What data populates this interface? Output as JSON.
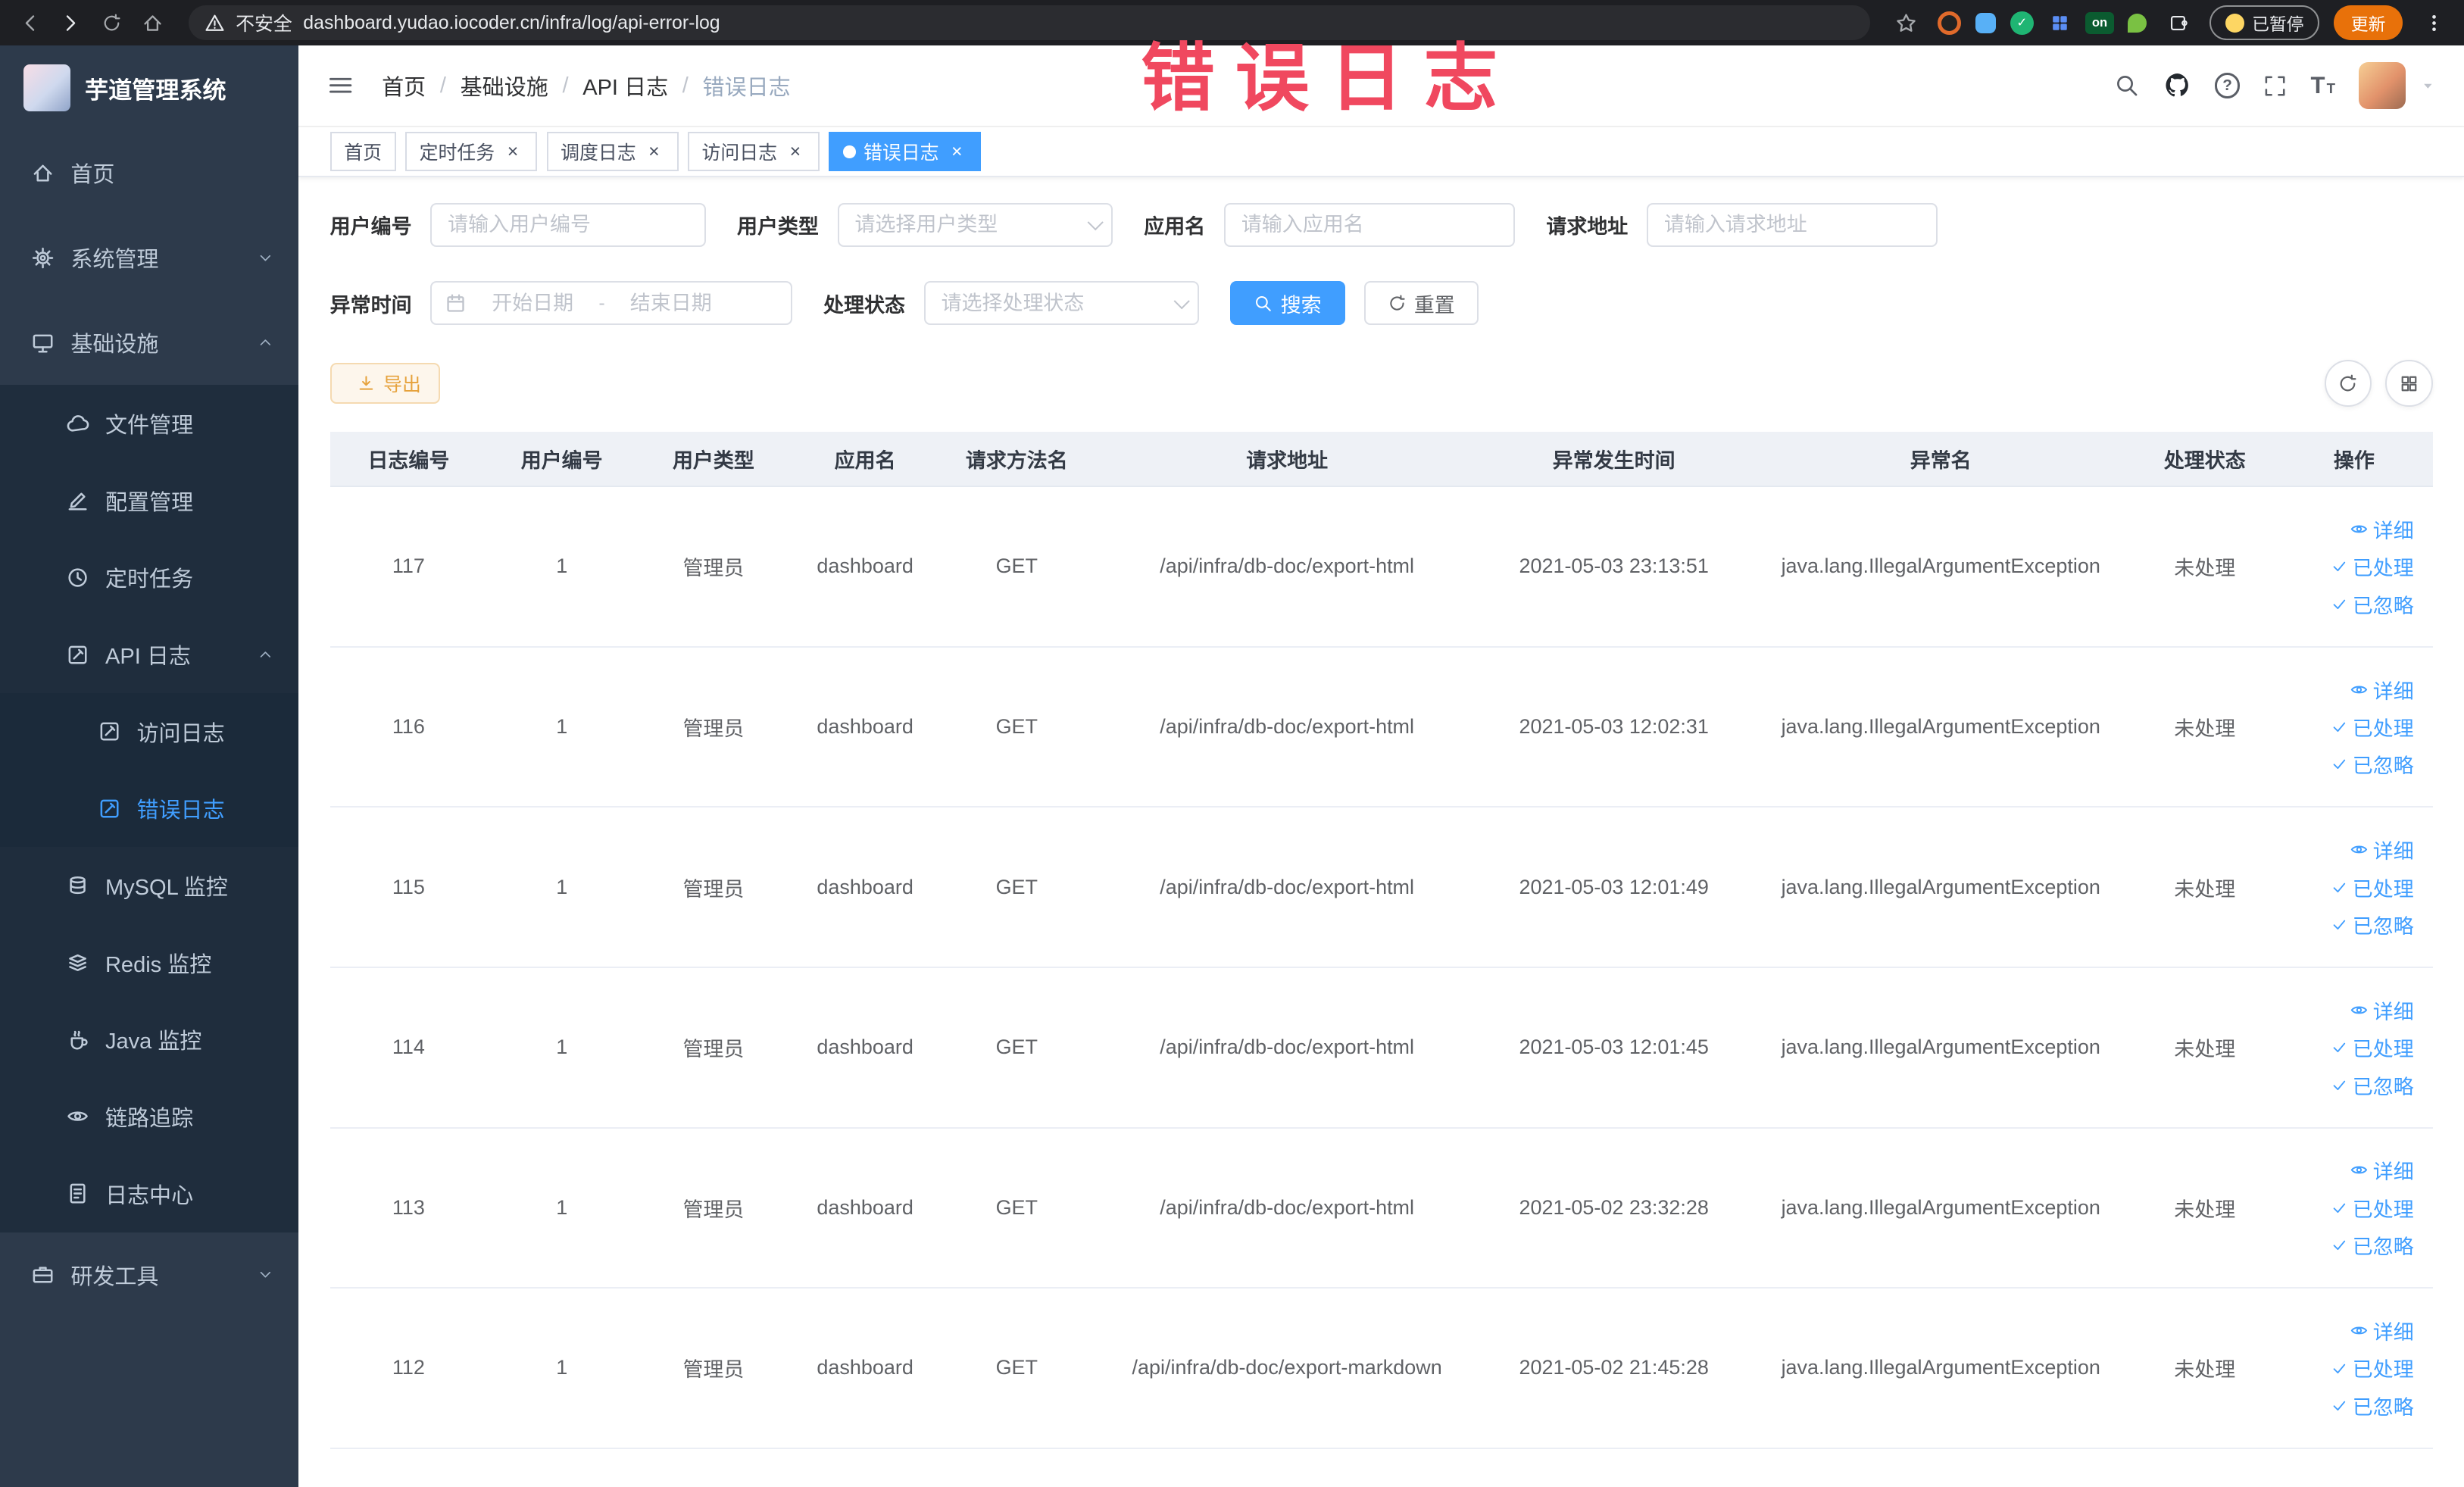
{
  "colors": {
    "primary": "#409EFF",
    "sidebar_bg": "#2d3a4b",
    "sidebar_submenu_bg": "#1f2d3d",
    "sidebar_text": "#bfcbd9",
    "table_header_bg": "#eef1f6",
    "warning_text": "#e6a23c",
    "warning_bg": "#fdf6ec",
    "watermark_color": "#f0485f",
    "chrome_bg": "#1e1f23",
    "update_badge_bg": "#e8710a"
  },
  "browser": {
    "security_warning": "不安全",
    "url": "dashboard.yudao.iocoder.cn/infra/log/api-error-log",
    "extensions_badge": "on",
    "paused_badge": "已暂停",
    "update_button": "更新"
  },
  "watermark": "错误日志",
  "sidebar": {
    "logo_title": "芋道管理系统",
    "items": [
      {
        "label": "首页",
        "icon": "home-icon"
      },
      {
        "label": "系统管理",
        "icon": "gear-icon",
        "arrow": "down"
      },
      {
        "label": "基础设施",
        "icon": "monitor-icon",
        "arrow": "up"
      },
      {
        "label": "文件管理",
        "icon": "cloud-icon"
      },
      {
        "label": "配置管理",
        "icon": "pencil-icon"
      },
      {
        "label": "定时任务",
        "icon": "clock-icon"
      },
      {
        "label": "API 日志",
        "icon": "edit-square-icon",
        "arrow": "up"
      },
      {
        "label": "访问日志",
        "icon": "edit-square-icon"
      },
      {
        "label": "错误日志",
        "icon": "edit-square-icon",
        "active": true
      },
      {
        "label": "MySQL 监控",
        "icon": "database-icon"
      },
      {
        "label": "Redis 监控",
        "icon": "redis-icon"
      },
      {
        "label": "Java 监控",
        "icon": "coffee-icon"
      },
      {
        "label": "链路追踪",
        "icon": "eye-icon"
      },
      {
        "label": "日志中心",
        "icon": "document-icon"
      },
      {
        "label": "研发工具",
        "icon": "toolbox-icon",
        "arrow": "down"
      }
    ]
  },
  "breadcrumb": {
    "separator": "/",
    "items": [
      "首页",
      "基础设施",
      "API 日志",
      "错误日志"
    ]
  },
  "tags": [
    {
      "label": "首页",
      "closable": false,
      "active": false
    },
    {
      "label": "定时任务",
      "closable": true,
      "active": false
    },
    {
      "label": "调度日志",
      "closable": true,
      "active": false
    },
    {
      "label": "访问日志",
      "closable": true,
      "active": false
    },
    {
      "label": "错误日志",
      "closable": true,
      "active": true
    }
  ],
  "filters": {
    "user_id": {
      "label": "用户编号",
      "placeholder": "请输入用户编号"
    },
    "user_type": {
      "label": "用户类型",
      "placeholder": "请选择用户类型"
    },
    "app_name": {
      "label": "应用名",
      "placeholder": "请输入应用名"
    },
    "request_url": {
      "label": "请求地址",
      "placeholder": "请输入请求地址"
    },
    "exception_time": {
      "label": "异常时间",
      "start_placeholder": "开始日期",
      "end_placeholder": "结束日期",
      "separator": "-"
    },
    "process_status": {
      "label": "处理状态",
      "placeholder": "请选择处理状态"
    },
    "search_button": "搜索",
    "reset_button": "重置"
  },
  "toolbar": {
    "export_button": "导出"
  },
  "table": {
    "columns": [
      "日志编号",
      "用户编号",
      "用户类型",
      "应用名",
      "请求方法名",
      "请求地址",
      "异常发生时间",
      "异常名",
      "处理状态",
      "操作"
    ],
    "actions": {
      "detail": "详细",
      "processed": "已处理",
      "ignored": "已忽略"
    },
    "rows": [
      {
        "log_id": "117",
        "user_id": "1",
        "user_type": "管理员",
        "app_name": "dashboard",
        "method": "GET",
        "url": "/api/infra/db-doc/export-html",
        "time": "2021-05-03 23:13:51",
        "exception": "java.lang.IllegalArgumentException",
        "status": "未处理"
      },
      {
        "log_id": "116",
        "user_id": "1",
        "user_type": "管理员",
        "app_name": "dashboard",
        "method": "GET",
        "url": "/api/infra/db-doc/export-html",
        "time": "2021-05-03 12:02:31",
        "exception": "java.lang.IllegalArgumentException",
        "status": "未处理"
      },
      {
        "log_id": "115",
        "user_id": "1",
        "user_type": "管理员",
        "app_name": "dashboard",
        "method": "GET",
        "url": "/api/infra/db-doc/export-html",
        "time": "2021-05-03 12:01:49",
        "exception": "java.lang.IllegalArgumentException",
        "status": "未处理"
      },
      {
        "log_id": "114",
        "user_id": "1",
        "user_type": "管理员",
        "app_name": "dashboard",
        "method": "GET",
        "url": "/api/infra/db-doc/export-html",
        "time": "2021-05-03 12:01:45",
        "exception": "java.lang.IllegalArgumentException",
        "status": "未处理"
      },
      {
        "log_id": "113",
        "user_id": "1",
        "user_type": "管理员",
        "app_name": "dashboard",
        "method": "GET",
        "url": "/api/infra/db-doc/export-html",
        "time": "2021-05-02 23:32:28",
        "exception": "java.lang.IllegalArgumentException",
        "status": "未处理"
      },
      {
        "log_id": "112",
        "user_id": "1",
        "user_type": "管理员",
        "app_name": "dashboard",
        "method": "GET",
        "url": "/api/infra/db-doc/export-markdown",
        "time": "2021-05-02 21:45:28",
        "exception": "java.lang.IllegalArgumentException",
        "status": "未处理"
      }
    ]
  }
}
